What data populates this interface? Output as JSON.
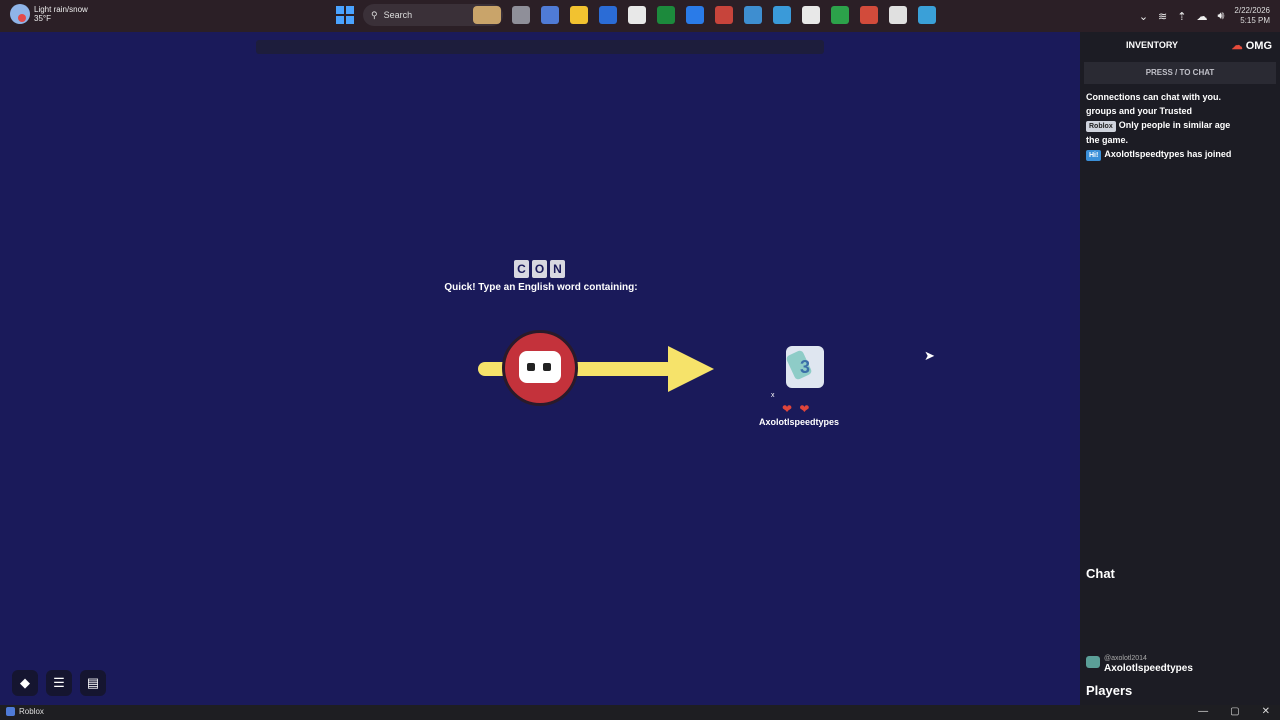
{
  "taskbar": {
    "weather_line1": "Light rain/snow",
    "weather_line2": "35°F",
    "search_placeholder": "Search",
    "clock_date": "2/22/2026",
    "clock_time": "5:15 PM",
    "apps": [
      {
        "name": "file-explorer",
        "color": "#8f8f99"
      },
      {
        "name": "roblox",
        "color": "#4f7bd6"
      },
      {
        "name": "folder",
        "color": "#f2c230"
      },
      {
        "name": "word",
        "color": "#2b6cd6"
      },
      {
        "name": "app-grid",
        "color": "#e8e8e8"
      },
      {
        "name": "excel",
        "color": "#1c8a3c"
      },
      {
        "name": "dropbox",
        "color": "#2a7be8"
      },
      {
        "name": "paint",
        "color": "#c7443b"
      },
      {
        "name": "monitor",
        "color": "#3e8ed0"
      },
      {
        "name": "notepad",
        "color": "#3a9ad9"
      },
      {
        "name": "chrome",
        "color": "#e8e8e8"
      },
      {
        "name": "chrome-green",
        "color": "#2ca24a"
      },
      {
        "name": "shop",
        "color": "#d24b3b"
      },
      {
        "name": "steam",
        "color": "#e0e0e0"
      },
      {
        "name": "desktop",
        "color": "#3aa0d8"
      }
    ]
  },
  "game": {
    "prompt_letters": [
      "C",
      "O",
      "N"
    ],
    "prompt_text": "Quick! Type an English word containing:",
    "player_name": "Axolotlspeedtypes",
    "lives": "❤ ❤",
    "small_mark": "x",
    "avatar_number": "3"
  },
  "bottom_buttons": [
    "roblox-logo",
    "menu",
    "backpack"
  ],
  "panel": {
    "inventory": "INVENTORY",
    "omg": "OMG",
    "chat_hint": "PRESS / TO CHAT",
    "messages": {
      "m1": "Connections can chat with you.",
      "m2": "groups and your Trusted",
      "m3_tag": "Roblox",
      "m3": "Only people in similar age",
      "m4": "the game.",
      "m5_tag": "Hi!",
      "m5": "Axolotlspeedtypes has joined"
    },
    "chat_label": "Chat",
    "player_sub": "@axolotl2014",
    "player_name": "Axolotlspeedtypes",
    "players_label": "Players"
  },
  "window": {
    "title": "Roblox",
    "minimize": "—",
    "maximize": "▢",
    "close": "✕"
  }
}
